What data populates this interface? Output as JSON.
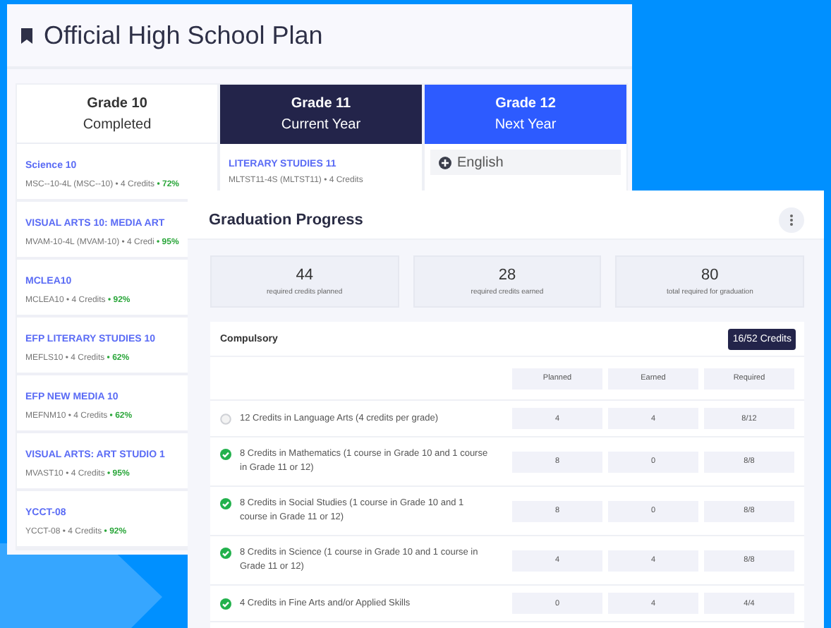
{
  "plan": {
    "title": "Official High School Plan",
    "grades": [
      {
        "title": "Grade 10",
        "subtitle": "Completed",
        "kind": "completed",
        "courses": [
          {
            "name": "Science 10",
            "meta": "MSC--10-4L (MSC--10) • 4 Credits",
            "score": "• 72%"
          },
          {
            "name": "VISUAL ARTS 10: MEDIA ART",
            "meta": "MVAM-10-4L (MVAM-10) • 4 Credi",
            "score": "• 95%"
          },
          {
            "name": "MCLEA10",
            "meta": "MCLEA10 • 4 Credits",
            "score": "• 92%"
          },
          {
            "name": "EFP LITERARY STUDIES 10",
            "meta": "MEFLS10 • 4 Credits",
            "score": "• 62%"
          },
          {
            "name": "EFP NEW MEDIA 10",
            "meta": "MEFNM10 • 4 Credits",
            "score": "• 62%"
          },
          {
            "name": "VISUAL ARTS: ART STUDIO 1",
            "meta": "MVAST10 • 4 Credits",
            "score": "• 95%"
          },
          {
            "name": "YCCT-08",
            "meta": "YCCT-08 • 4 Credits",
            "score": "• 92%"
          }
        ]
      },
      {
        "title": "Grade 11",
        "subtitle": "Current Year",
        "kind": "current",
        "courses": [
          {
            "name": "LITERARY STUDIES 11",
            "meta": "MLTST11-4S (MLTST11) • 4 Credits"
          }
        ]
      },
      {
        "title": "Grade 12",
        "subtitle": "Next Year",
        "kind": "next",
        "slots": [
          "English"
        ]
      }
    ]
  },
  "progress": {
    "title": "Graduation Progress",
    "stats": [
      {
        "value": "44",
        "label": "required credits planned"
      },
      {
        "value": "28",
        "label": "required credits earned"
      },
      {
        "value": "80",
        "label": "total required for graduation"
      }
    ],
    "section": {
      "title": "Compulsory",
      "badge": "16/52 Credits",
      "columns": [
        "Planned",
        "Earned",
        "Required"
      ],
      "rows": [
        {
          "requirement": "12 Credits in Language Arts (4 credits per grade)",
          "met": false,
          "planned": "4",
          "earned": "4",
          "required": "8/12"
        },
        {
          "requirement": "8 Credits in Mathematics (1 course in Grade 10 and 1 course in Grade 11 or 12)",
          "met": true,
          "planned": "8",
          "earned": "0",
          "required": "8/8"
        },
        {
          "requirement": "8 Credits in Social Studies (1 course in Grade 10 and 1 course in Grade 11 or 12)",
          "met": true,
          "planned": "8",
          "earned": "0",
          "required": "8/8"
        },
        {
          "requirement": "8 Credits in Science (1 course in Grade 10 and 1 course in Grade 11 or 12)",
          "met": true,
          "planned": "4",
          "earned": "4",
          "required": "8/8"
        },
        {
          "requirement": "4 Credits in Fine Arts and/or Applied Skills",
          "met": true,
          "planned": "0",
          "earned": "4",
          "required": "4/4"
        }
      ]
    }
  }
}
